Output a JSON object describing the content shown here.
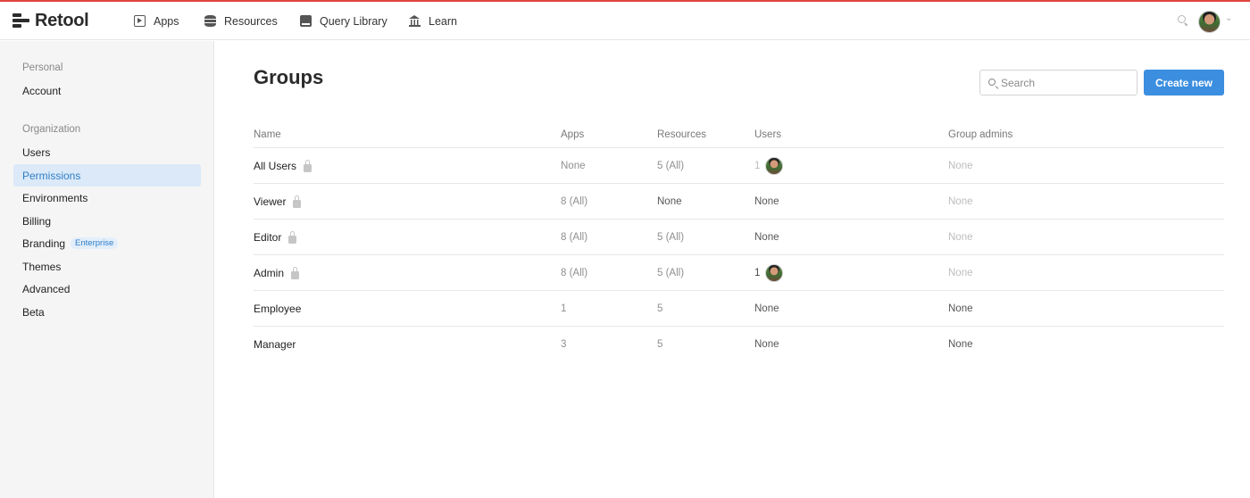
{
  "brand": {
    "name": "Retool"
  },
  "topnav": [
    {
      "label": "Apps",
      "icon": "play-box-icon"
    },
    {
      "label": "Resources",
      "icon": "database-icon"
    },
    {
      "label": "Query Library",
      "icon": "book-icon"
    },
    {
      "label": "Learn",
      "icon": "bank-icon"
    }
  ],
  "sidebar": {
    "sections": [
      {
        "heading": "Personal",
        "items": [
          {
            "label": "Account"
          }
        ]
      },
      {
        "heading": "Organization",
        "items": [
          {
            "label": "Users"
          },
          {
            "label": "Permissions",
            "active": true
          },
          {
            "label": "Environments"
          },
          {
            "label": "Billing"
          },
          {
            "label": "Branding",
            "badge": "Enterprise"
          },
          {
            "label": "Themes"
          },
          {
            "label": "Advanced"
          },
          {
            "label": "Beta"
          }
        ]
      }
    ]
  },
  "main": {
    "title": "Groups",
    "search_placeholder": "Search",
    "create_label": "Create new"
  },
  "table": {
    "columns": [
      "Name",
      "Apps",
      "Resources",
      "Users",
      "Group admins"
    ],
    "rows": [
      {
        "name": "All Users",
        "locked": true,
        "apps": "None",
        "resources": "5 (All)",
        "users": "1",
        "users_avatar": true,
        "admins": "None"
      },
      {
        "name": "Viewer",
        "locked": true,
        "apps": "8 (All)",
        "resources": "None",
        "users": "None",
        "users_avatar": false,
        "admins": "None"
      },
      {
        "name": "Editor",
        "locked": true,
        "apps": "8 (All)",
        "resources": "5 (All)",
        "users": "None",
        "users_avatar": false,
        "admins": "None"
      },
      {
        "name": "Admin",
        "locked": true,
        "apps": "8 (All)",
        "resources": "5 (All)",
        "users": "1",
        "users_avatar": true,
        "admins": "None"
      },
      {
        "name": "Employee",
        "locked": false,
        "apps": "1",
        "resources": "5",
        "users": "None",
        "users_avatar": false,
        "admins": "None"
      },
      {
        "name": "Manager",
        "locked": false,
        "apps": "3",
        "resources": "5",
        "users": "None",
        "users_avatar": false,
        "admins": "None"
      }
    ]
  },
  "colors": {
    "accent": "#3b8ee0",
    "active_bg": "#dbe9f8",
    "top_border": "#e0443c"
  }
}
